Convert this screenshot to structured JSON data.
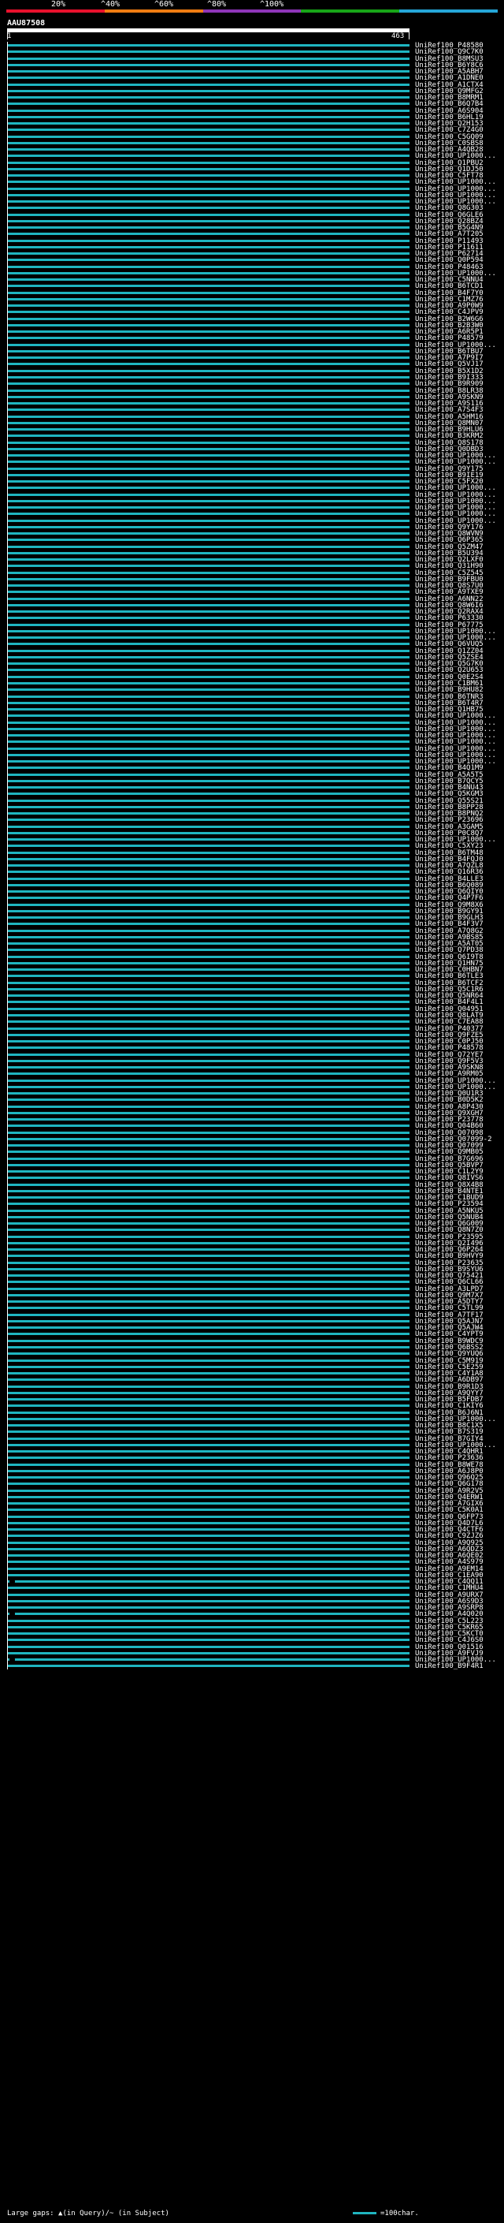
{
  "header": {
    "percent_labels": [
      "20%",
      "^40%",
      "^60%",
      "^80%",
      "^100%"
    ],
    "color_bar": [
      "#e8112d",
      "#ef7c12",
      "#8e35b8",
      "#18a518",
      "#25a6d8"
    ],
    "query_id": "AAU87508",
    "query_start": "1",
    "query_end": "463"
  },
  "colors": {
    "hit_bar": "#1fb5c0",
    "background": "#000000",
    "text": "#ffffff"
  },
  "hits": [
    "UniRef100_P48580",
    "UniRef100_Q9C7K0",
    "UniRef100_B8MSU3",
    "UniRef100_B6Y8C6",
    "UniRef100_A5ABH7",
    "UniRef100_A1DNE0",
    "UniRef100_A1CTX4",
    "UniRef100_Q9MFG2",
    "UniRef100_B8MRM1",
    "UniRef100_B6Q7B4",
    "UniRef100_A6S904",
    "UniRef100_B6HL19",
    "UniRef100_Q2H153",
    "UniRef100_C7Z4G0",
    "UniRef100_C5GQ09",
    "UniRef100_C0SBS8",
    "UniRef100_A4QB28",
    "UniRef100_UP1000...",
    "UniRef100_Q1PBU2",
    "UniRef100_Q1DJ50",
    "UniRef100_C5FT78",
    "UniRef100_UP1000...",
    "UniRef100_UP1000...",
    "UniRef100_UP1000...",
    "UniRef100_UP1000...",
    "UniRef100_Q8G303",
    "UniRef100_Q6GLE6",
    "UniRef100_Q28BZ4",
    "UniRef100_B5G4N9",
    "UniRef100_A7T205",
    "UniRef100_P11493",
    "UniRef100_P11611",
    "UniRef100_P62714",
    "UniRef100_Q0P594",
    "UniRef100_P48463",
    "UniRef100_UP1000...",
    "UniRef100_C5NNU4",
    "UniRef100_B6TCD1",
    "UniRef100_B4F7Y0",
    "UniRef100_C1MZ76",
    "UniRef100_A9P0W9",
    "UniRef100_C4JPV9",
    "UniRef100_B2W6G6",
    "UniRef100_B2B3W0",
    "UniRef100_A6R5P1",
    "UniRef100_P48579",
    "UniRef100_UP1000...",
    "UniRef100_B6TBU7",
    "UniRef100_A7P9I7",
    "UniRef100_Q5VJ17",
    "UniRef100_B5X1D2",
    "UniRef100_B9I333",
    "UniRef100_B9R909",
    "UniRef100_B8LR38",
    "UniRef100_A9SKN9",
    "UniRef100_A9S116",
    "UniRef100_A7S4F3",
    "UniRef100_A5HM16",
    "UniRef100_Q8MN07",
    "UniRef100_B9HLU6",
    "UniRef100_B3KRM2",
    "UniRef100_Q8S178",
    "UniRef100_Q0DBD3",
    "UniRef100_UP1000...",
    "UniRef100_UP1000...",
    "UniRef100_Q9Y175",
    "UniRef100_B9IE19",
    "UniRef100_C5FX20",
    "UniRef100_UP1000...",
    "UniRef100_UP1000...",
    "UniRef100_UP1000...",
    "UniRef100_UP1000...",
    "UniRef100_UP1000...",
    "UniRef100_UP1000...",
    "UniRef100_Q9Y176",
    "UniRef100_Q8WVN9",
    "UniRef100_Q6P365",
    "UniRef100_Q5ZM47",
    "UniRef100_B5U394",
    "UniRef100_Q2LXF0",
    "UniRef100_Q31H90",
    "UniRef100_C5Z545",
    "UniRef100_B9FBU0",
    "UniRef100_Q8S7U0",
    "UniRef100_A9TXE9",
    "UniRef100_A6NN22",
    "UniRef100_Q8W6I6",
    "UniRef100_Q2RAX4",
    "UniRef100_P63330",
    "UniRef100_P67775",
    "UniRef100_UP1000...",
    "UniRef100_UP1000...",
    "UniRef100_Q6VUQ5",
    "UniRef100_Q1ZZ04",
    "UniRef100_Q5ZSE4",
    "UniRef100_Q5G7K0",
    "UniRef100_Q2U653",
    "UniRef100_Q0E2S4",
    "UniRef100_C1BM61",
    "UniRef100_B9HU82",
    "UniRef100_B6TNR3",
    "UniRef100_B6T4R7",
    "UniRef100_Q1HB75",
    "UniRef100_UP1000...",
    "UniRef100_UP1000...",
    "UniRef100_UP1000...",
    "UniRef100_UP1000...",
    "UniRef100_UP1000...",
    "UniRef100_UP1000...",
    "UniRef100_UP1000...",
    "UniRef100_UP1000...",
    "UniRef100_B4Q1M9",
    "UniRef100_A5A5T5",
    "UniRef100_B7QCY5",
    "UniRef100_B4NU43",
    "UniRef100_Q5KGM3",
    "UniRef100_Q55S21",
    "UniRef100_B8PP28",
    "UniRef100_B8PNQ2",
    "UniRef100_P23696",
    "UniRef100_A3GAM5",
    "UniRef100_P0C8Q7",
    "UniRef100_UP1000...",
    "UniRef100_C5XY23",
    "UniRef100_B6TM48",
    "UniRef100_B4FQJ0",
    "UniRef100_A7QZL8",
    "UniRef100_Q16R36",
    "UniRef100_B4LLE3",
    "UniRef100_B6Q089",
    "UniRef100_Q6QIY0",
    "UniRef100_Q4P7F6",
    "UniRef100_Q9M8X6",
    "UniRef100_B9GY91",
    "UniRef100_B9GLH3",
    "UniRef100_B4F3V7",
    "UniRef100_A7Q8G2",
    "UniRef100_A9BS85",
    "UniRef100_A5AT05",
    "UniRef100_Q7PD38",
    "UniRef100_Q6I9T8",
    "UniRef100_Q1HN75",
    "UniRef100_C0HBN7",
    "UniRef100_B6TLE3",
    "UniRef100_B6TCF2",
    "UniRef100_Q5C1R6",
    "UniRef100_Q5NR64",
    "UniRef100_B4F4L1",
    "UniRef100_Q04951",
    "UniRef100_Q8LAT9",
    "UniRef100_C7EA88",
    "UniRef100_P40377",
    "UniRef100_Q9FZE5",
    "UniRef100_C0PJ50",
    "UniRef100_P48578",
    "UniRef100_Q72YE7",
    "UniRef100_Q9F5V3",
    "UniRef100_A9SKN8",
    "UniRef100_A9RM05",
    "UniRef100_UP1000...",
    "UniRef100_UP1000...",
    "UniRef100_Q0U1R3",
    "UniRef100_B0D5K2",
    "UniRef100_A8P430",
    "UniRef100_Q9XGH7",
    "UniRef100_P23778",
    "UniRef100_Q04B60",
    "UniRef100_Q07098",
    "UniRef100_Q07099-2",
    "UniRef100_Q07099",
    "UniRef100_Q9MB05",
    "UniRef100_B7G696",
    "UniRef100_Q5BVP7",
    "UniRef100_C1L2Y9",
    "UniRef100_Q8IVS6",
    "UniRef100_Q8X4B8",
    "UniRef100_B4NTE1",
    "UniRef100_C1BUD9",
    "UniRef100_P23594",
    "UniRef100_A5NKU5",
    "UniRef100_Q5NUB4",
    "UniRef100_Q6G009",
    "UniRef100_Q8N7Z0",
    "UniRef100_P23595",
    "UniRef100_Q2I496",
    "UniRef100_Q6P264",
    "UniRef100_B9HVY9",
    "UniRef100_P23635",
    "UniRef100_B9SYU6",
    "UniRef100_Q75421",
    "UniRef100_Q6CL66",
    "UniRef100_A3LPD7",
    "UniRef100_Q9M7X7",
    "UniRef100_A5DTY7",
    "UniRef100_C5TL99",
    "UniRef100_A7TF17",
    "UniRef100_Q5AJN7",
    "UniRef100_Q5AJW4",
    "UniRef100_C4YPT9",
    "UniRef100_B9WDC9",
    "UniRef100_Q6BSS2",
    "UniRef100_Q9YUQ6",
    "UniRef100_C5M919",
    "UniRef100_C5E259",
    "UniRef100_C4Y1A8",
    "UniRef100_A6DB97",
    "UniRef100_B9R1D3",
    "UniRef100_A9QYY7",
    "UniRef100_B5FDB7",
    "UniRef100_C1KIY6",
    "UniRef100_B6J6N1",
    "UniRef100_UP1000...",
    "UniRef100_B8C1X5",
    "UniRef100_B7S319",
    "UniRef100_B7GIY4",
    "UniRef100_UP1000...",
    "UniRef100_C4QHR1",
    "UniRef100_P23636",
    "UniRef100_B8WE78",
    "UniRef100_A6J8P0",
    "UniRef100_Q96Q25",
    "UniRef100_Q6G178",
    "UniRef100_A9R2V5",
    "UniRef100_Q4ERW1",
    "UniRef100_A7GIX6",
    "UniRef100_C5K0A1",
    "UniRef100_Q6FP73",
    "UniRef100_Q4D7L6",
    "UniRef100_Q4CTF6",
    "UniRef100_C9ZJZ6",
    "UniRef100_A9Q925",
    "UniRef100_A6QDZ3",
    "UniRef100_A6QE02",
    "UniRef100_A4S979",
    "UniRef100_A9EM14",
    "UniRef100_C1EA90",
    "UniRef100_C4QQ11",
    "UniRef100_C1MHU4",
    "UniRef100_A9URX7",
    "UniRef100_A6S9D3",
    "UniRef100_A9SRP8",
    "UniRef100_A4Q020",
    "UniRef100_C5L223",
    "UniRef100_C5KR65",
    "UniRef100_C5KCT0",
    "UniRef100_C4J6S0",
    "UniRef100_Q01516",
    "UniRef100_A9FVJ9",
    "UniRef100_UP1000...",
    "UniRef100_B9F4R1"
  ],
  "footer": {
    "legend_text": "Large gaps: ▲(in Query)/~ (in Subject)",
    "scale_text": "=100char."
  }
}
